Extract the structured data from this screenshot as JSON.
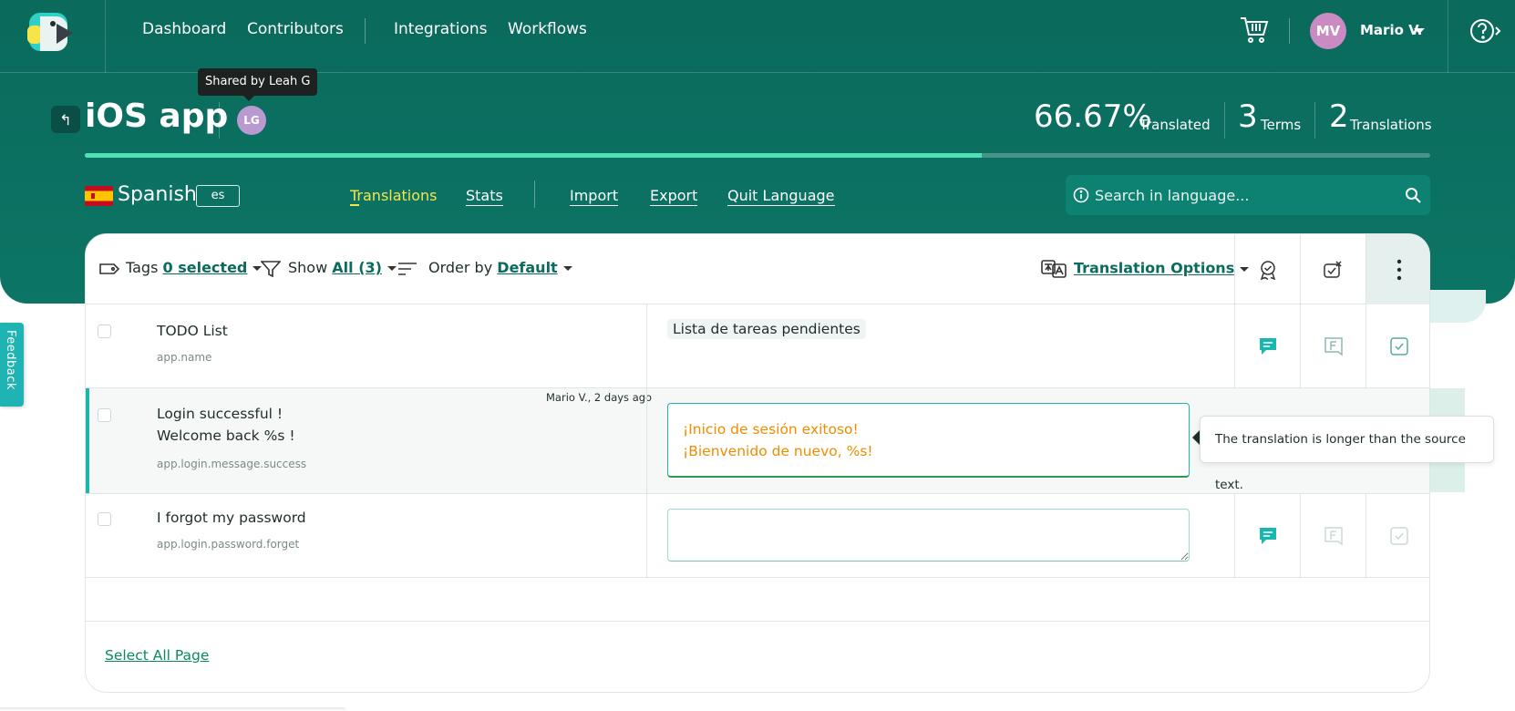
{
  "nav": {
    "links": [
      "Dashboard",
      "Contributors",
      "Integrations",
      "Workflows"
    ],
    "user_initials": "MV",
    "user_name": "Mario V."
  },
  "tooltip_shared": "Shared by Leah G",
  "project": {
    "title": "iOS app",
    "shared_initials": "LG",
    "translated_pct": "66.67%",
    "translated_label": "Translated",
    "progress_fraction": 0.6667,
    "terms_count": "3",
    "terms_label": "Terms",
    "translations_count": "2",
    "translations_label": "Translations"
  },
  "language": {
    "name": "Spanish",
    "code": "es",
    "tabs": [
      "Translations",
      "Stats",
      "Import",
      "Export",
      "Quit Language"
    ],
    "search_placeholder": "Search in language..."
  },
  "toolbar": {
    "tags_label": "Tags",
    "tags_value": "0 selected",
    "show_label": "Show",
    "show_value": "All (3)",
    "order_label": "Order by",
    "order_value": "Default",
    "translation_options": "Translation Options"
  },
  "rows": [
    {
      "text": "TODO List",
      "key": "app.name",
      "translation": "Lista de tareas pendientes"
    },
    {
      "text_line1": "Login successful !",
      "text_line2": "Welcome back %s !",
      "key": "app.login.message.success",
      "meta": "Mario V., 2 days ago",
      "translation_line1": "¡Inicio de sesión exitoso!",
      "translation_line2": "¡Bienvenido de nuevo, %s!"
    },
    {
      "text": "I forgot my password",
      "key": "app.login.password.forget",
      "translation": ""
    }
  ],
  "warning_tooltip": "The translation is longer than the source text.",
  "footer": {
    "select_all": "Select All Page"
  },
  "feedback_label": "Feedback",
  "colors": {
    "brand": "#0b6b5e",
    "progress": "#4fe0b8",
    "active_tab": "#f5e54a",
    "edit_text": "#f08c00",
    "accent": "#1cb6b1"
  }
}
